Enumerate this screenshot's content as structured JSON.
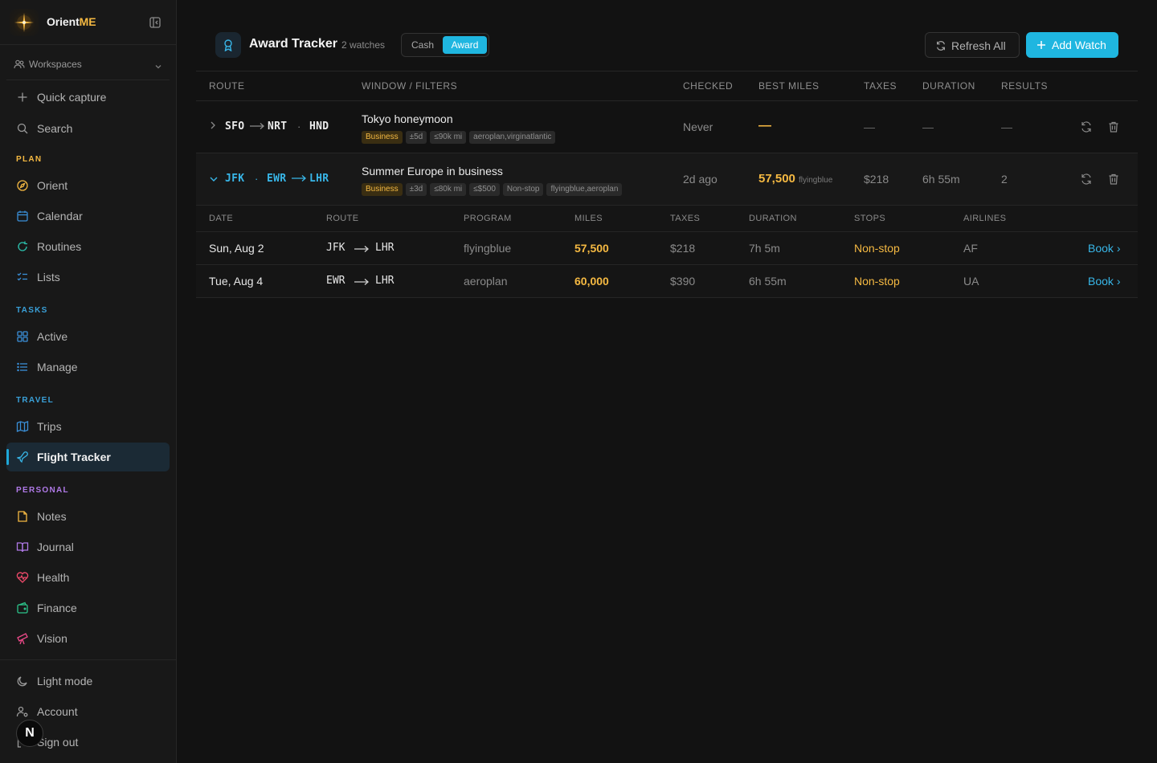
{
  "brand": {
    "name_prefix": "Orient",
    "name_suffix": "ME"
  },
  "sidebar": {
    "workspaces": "Workspaces",
    "quick_capture": "Quick capture",
    "search": "Search",
    "sections": {
      "plan": "PLAN",
      "tasks": "TASKS",
      "travel": "TRAVEL",
      "personal": "PERSONAL"
    },
    "plan_items": [
      "Orient",
      "Calendar",
      "Routines",
      "Lists"
    ],
    "task_items": [
      "Active",
      "Manage"
    ],
    "travel_items": [
      "Trips",
      "Flight Tracker"
    ],
    "personal_items": [
      "Notes",
      "Journal",
      "Health",
      "Finance",
      "Vision"
    ],
    "footer_items": [
      "Light mode",
      "Account",
      "Sign out"
    ],
    "section_colors": {
      "plan": "#f5b942",
      "tasks": "#3aa0d8",
      "travel": "#3aa0d8",
      "personal": "#b07ae8"
    }
  },
  "header": {
    "title": "Award Tracker",
    "watch_count": "2 watches",
    "mode_cash": "Cash",
    "mode_award": "Award",
    "refresh_label": "Refresh All",
    "add_label": "Add Watch"
  },
  "table": {
    "columns": [
      "ROUTE",
      "WINDOW / FILTERS",
      "CHECKED",
      "BEST MILES",
      "TAXES",
      "DURATION",
      "RESULTS"
    ],
    "rows": [
      {
        "origin": "SFO",
        "dest1": "NRT",
        "dest2": "HND",
        "name": "Tokyo honeymoon",
        "tags": [
          "Business",
          "±5d",
          "≤90k mi",
          "aeroplan,virginatlantic"
        ],
        "checked": "Never",
        "best_miles": "—",
        "taxes": "—",
        "duration": "—",
        "results": "—"
      },
      {
        "origin1": "JFK",
        "origin2": "EWR",
        "dest": "LHR",
        "name": "Summer Europe in business",
        "tags": [
          "Business",
          "±3d",
          "≤80k mi",
          "≤$500",
          "Non-stop",
          "flyingblue,aeroplan"
        ],
        "checked": "2d ago",
        "best_miles": "57,500",
        "best_program": "flyingblue",
        "taxes": "$218",
        "duration": "6h 55m",
        "results": "2"
      }
    ]
  },
  "results": {
    "columns": [
      "DATE",
      "ROUTE",
      "PROGRAM",
      "MILES",
      "TAXES",
      "DURATION",
      "STOPS",
      "AIRLINES"
    ],
    "rows": [
      {
        "date": "Sun, Aug 2",
        "from": "JFK",
        "to": "LHR",
        "program": "flyingblue",
        "miles": "57,500",
        "taxes": "$218",
        "duration": "7h 5m",
        "stops": "Non-stop",
        "airline": "AF",
        "book": "Book"
      },
      {
        "date": "Tue, Aug 4",
        "from": "EWR",
        "to": "LHR",
        "program": "aeroplan",
        "miles": "60,000",
        "taxes": "$390",
        "duration": "6h 55m",
        "stops": "Non-stop",
        "airline": "UA",
        "book": "Book"
      }
    ]
  },
  "next_badge": "N"
}
